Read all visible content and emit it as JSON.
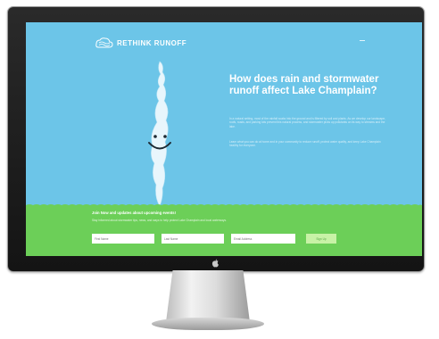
{
  "site": {
    "logo_text": "RETHINK RUNOFF"
  },
  "hero": {
    "title": "How does rain and stormwater runoff affect Lake Champlain?",
    "paragraph_1": "In a natural setting, most of the rainfall soaks into the ground and is filtered by soil and plants. As we develop our landscape, roofs, roads, and parking lots prevent this natural process, and stormwater picks up pollutants on its way to streams and the lake.",
    "paragraph_2": "Learn what you can do at home and in your community to reduce runoff, protect water quality, and keep Lake Champlain healthy for everyone."
  },
  "signup": {
    "title": "Join Now and updates about upcoming events!",
    "subtitle": "Stay informed about stormwater tips, news, and ways to help protect Lake Champlain and local waterways.",
    "first_name_placeholder": "First Name",
    "last_name_placeholder": "Last Name",
    "email_placeholder": "Email Address",
    "submit_label": "Sign Up"
  },
  "colors": {
    "sky": "#6cc5e8",
    "grass": "#6ccf58",
    "button": "#c8f2a6"
  },
  "icons": [
    "logo-cloud-icon",
    "menu-icon",
    "apple-logo-icon"
  ]
}
